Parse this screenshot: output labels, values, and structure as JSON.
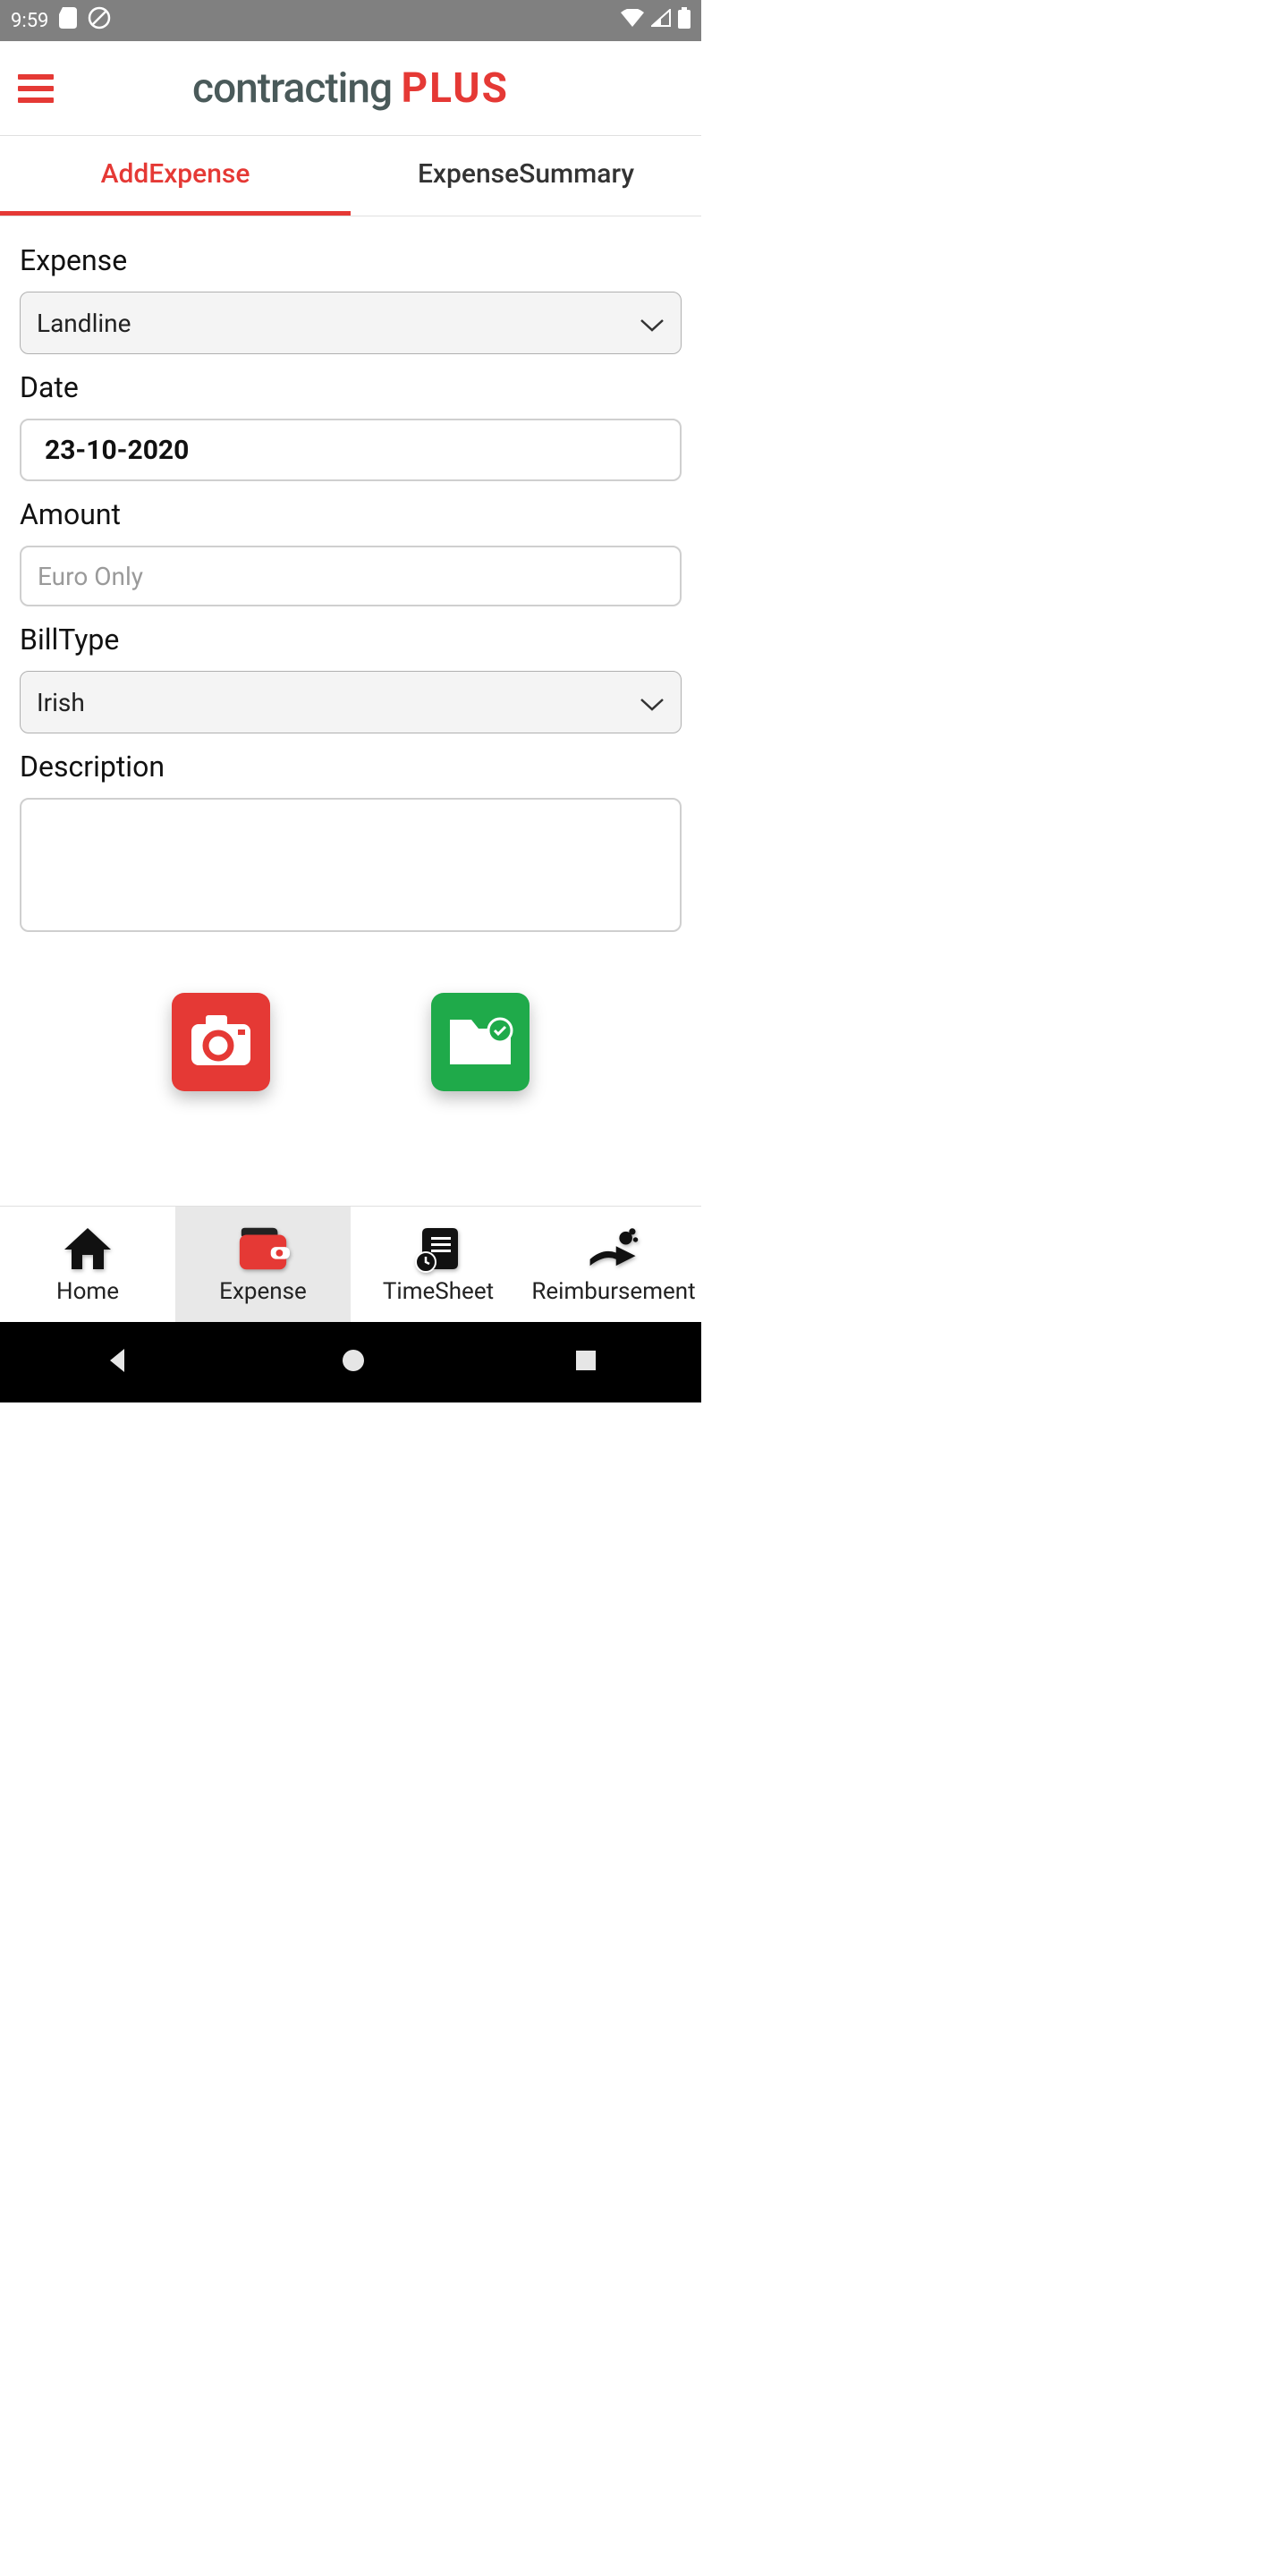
{
  "status": {
    "time": "9:59"
  },
  "brand": {
    "dark": "contracting",
    "red": "PLUS"
  },
  "tabs": {
    "add": "AddExpense",
    "summary": "ExpenseSummary"
  },
  "form": {
    "expense_label": "Expense",
    "expense_value": "Landline",
    "date_label": "Date",
    "date_value": "23-10-2020",
    "amount_label": "Amount",
    "amount_placeholder": "Euro Only",
    "billtype_label": "BillType",
    "billtype_value": "Irish",
    "description_label": "Description"
  },
  "nav": {
    "home": "Home",
    "expense": "Expense",
    "timesheet": "TimeSheet",
    "reimbursement": "Reimbursement"
  }
}
